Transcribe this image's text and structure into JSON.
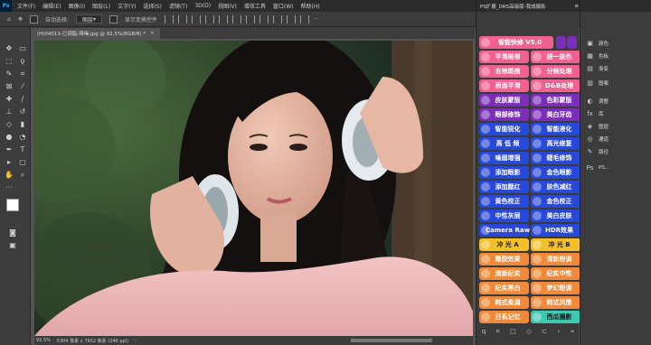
{
  "menu": [
    "文件(F)",
    "编辑(E)",
    "图像(I)",
    "图层(L)",
    "文字(Y)",
    "选择(S)",
    "滤镜(T)",
    "3D(D)",
    "视图(V)",
    "增效工具",
    "窗口(W)",
    "帮助(H)"
  ],
  "options": {
    "auto_select": "自动选择:",
    "layer_select": "图层",
    "show_transform": "显示变换控件",
    "more": "···"
  },
  "tab": {
    "title": "(H)04013-已调脂-降噪.jpg @ 92.5%(RGB/8) *",
    "close": "×"
  },
  "status": {
    "zoom": "92.5%",
    "doc": "5304 像素 x 7952 像素 (240 ppi)",
    "arrow": "›"
  },
  "plugin": {
    "title": "PS扩展_DR5高级版-我成摄影",
    "buttons": [
      [
        "智能快修 V5.0",
        "pink"
      ],
      [
        "平滑局部",
        "pink"
      ],
      [
        "统一肤色",
        "pink"
      ],
      [
        "去除斑痕",
        "pink"
      ],
      [
        "分频处理",
        "pink"
      ],
      [
        "表面平滑",
        "pink"
      ],
      [
        "D&B处理",
        "pink"
      ],
      [
        "皮肤蒙版",
        "purple"
      ],
      [
        "色彩蒙版",
        "purple"
      ],
      [
        "眼部修饰",
        "purple"
      ],
      [
        "美白牙齿",
        "purple"
      ],
      [
        "智能锐化",
        "blue"
      ],
      [
        "智能液化",
        "blue"
      ],
      [
        "高 低 频",
        "blue"
      ],
      [
        "高光修复",
        "blue"
      ],
      [
        "噪眉增强",
        "blue"
      ],
      [
        "睫毛修饰",
        "blue"
      ],
      [
        "添加眼影",
        "blue"
      ],
      [
        "金色眼影",
        "blue"
      ],
      [
        "添加腮红",
        "blue"
      ],
      [
        "肤色减红",
        "blue"
      ],
      [
        "黄色校正",
        "blue"
      ],
      [
        "金色校正",
        "blue"
      ],
      [
        "中性灰层",
        "blue"
      ],
      [
        "美白皮肤",
        "blue"
      ],
      [
        "Camera Raw",
        "blue"
      ],
      [
        "HDR效果",
        "blue"
      ],
      [
        "冲 光 A",
        "yellow"
      ],
      [
        "冲 光 B",
        "yellow"
      ],
      [
        "曝胶效果",
        "orange"
      ],
      [
        "清新粉调",
        "orange"
      ],
      [
        "清新纪实",
        "orange"
      ],
      [
        "纪实中性",
        "orange"
      ],
      [
        "纪实黑白",
        "orange"
      ],
      [
        "梦幻粉调",
        "orange"
      ],
      [
        "韩式柔调",
        "orange"
      ],
      [
        "韩式风情",
        "orange"
      ],
      [
        "日系记忆",
        "orange"
      ],
      [
        "西瓜摄影",
        "teal"
      ]
    ],
    "bottom_icons": [
      "q",
      "⌗",
      "□",
      "◇",
      "⊂",
      "‹",
      "»"
    ]
  },
  "side_panel": [
    {
      "icon": "▣",
      "label": "颜色"
    },
    {
      "icon": "▦",
      "label": "色板"
    },
    {
      "icon": "▤",
      "label": "渐变"
    },
    {
      "icon": "▥",
      "label": "图案"
    },
    {
      "icon": "◐",
      "label": "调整"
    },
    {
      "icon": "fx",
      "label": "库"
    },
    {
      "icon": "◈",
      "label": "图层"
    },
    {
      "icon": "◎",
      "label": "通道"
    },
    {
      "icon": "✎",
      "label": "路径"
    },
    {
      "icon": "Ps",
      "label": "PS..."
    }
  ]
}
